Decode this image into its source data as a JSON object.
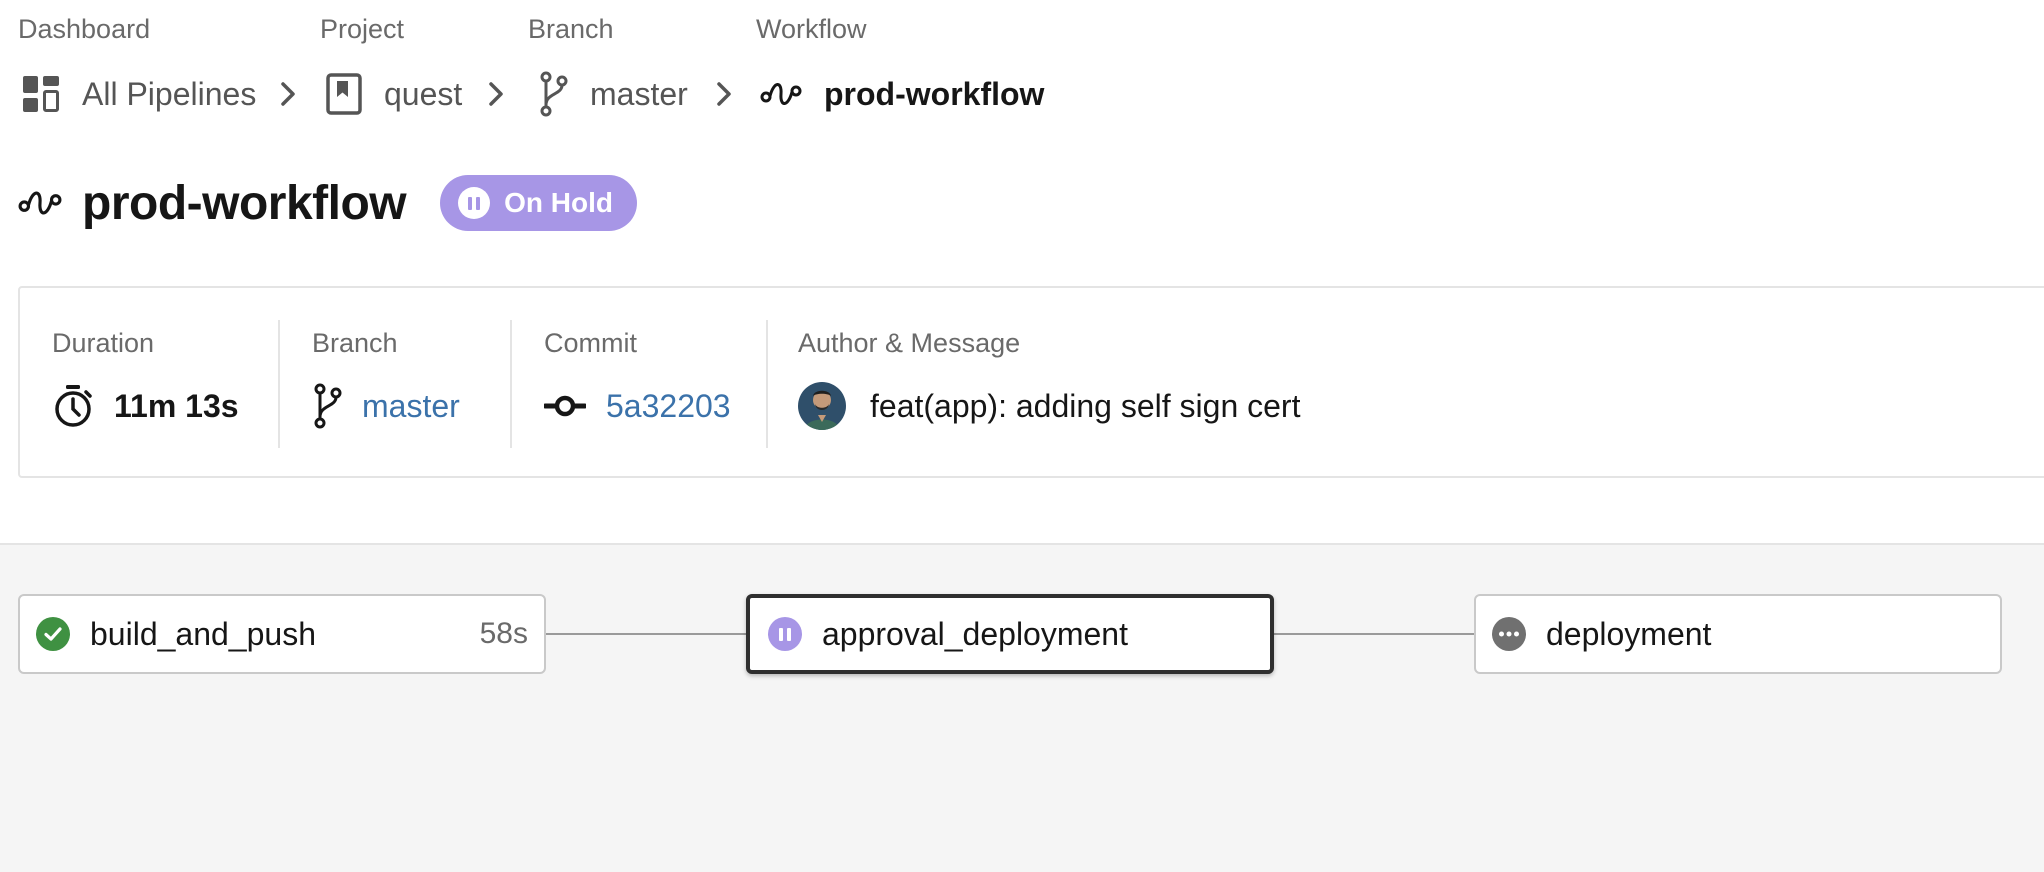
{
  "breadcrumb": {
    "labels": [
      "Dashboard",
      "Project",
      "Branch",
      "Workflow"
    ],
    "items": [
      {
        "text": "All Pipelines",
        "icon": "dashboard-icon"
      },
      {
        "text": "quest",
        "icon": "project-bookmark-icon"
      },
      {
        "text": "master",
        "icon": "branch-icon"
      },
      {
        "text": "prod-workflow",
        "icon": "workflow-icon"
      }
    ]
  },
  "header": {
    "title": "prod-workflow",
    "status": "On Hold",
    "status_color": "#a796e6"
  },
  "summary": {
    "duration_label": "Duration",
    "duration_value": "11m 13s",
    "branch_label": "Branch",
    "branch_value": "master",
    "commit_label": "Commit",
    "commit_value": "5a32203",
    "author_label": "Author & Message",
    "message": "feat(app): adding self sign cert",
    "link_color": "#3b72aa"
  },
  "jobs": [
    {
      "name": "build_and_push",
      "duration": "58s",
      "status": "success",
      "status_color": "#3f9142"
    },
    {
      "name": "approval_deployment",
      "duration": "",
      "status": "on-hold",
      "status_color": "#a796e6"
    },
    {
      "name": "deployment",
      "duration": "",
      "status": "blocked",
      "status_color": "#707070"
    }
  ]
}
